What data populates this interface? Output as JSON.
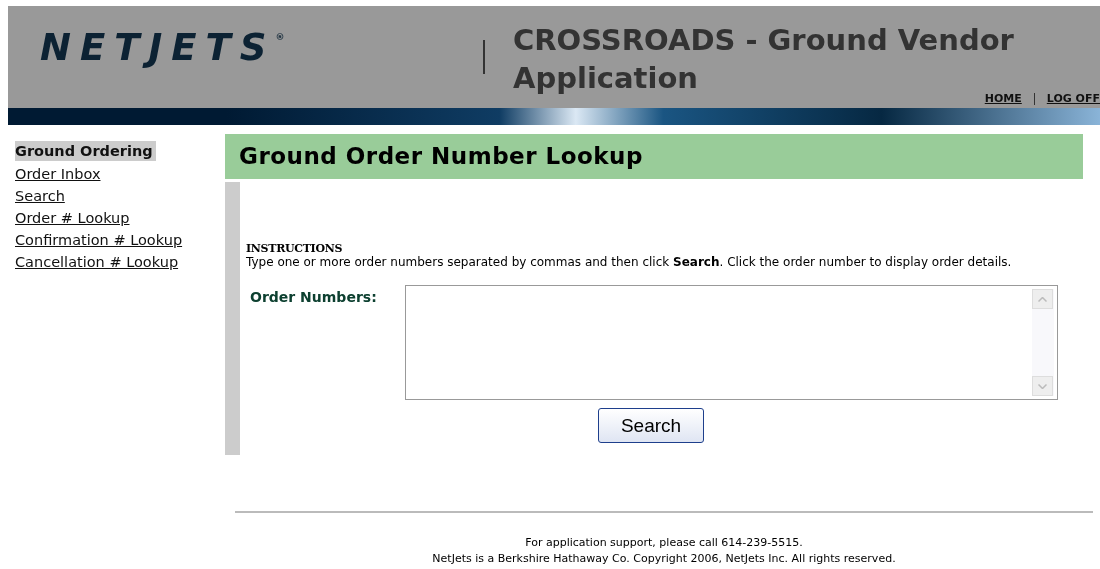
{
  "header": {
    "logo": "NETJETS",
    "logo_mark": "®",
    "title": "CROSSROADS - Ground Vendor Application",
    "nav": [
      {
        "label": "HOME"
      },
      {
        "label": "LOG OFF"
      }
    ]
  },
  "sidebar": {
    "items": [
      {
        "label": "Ground Ordering",
        "selected": true
      },
      {
        "label": "Order Inbox",
        "selected": false
      },
      {
        "label": "Search",
        "selected": false
      },
      {
        "label": "Order # Lookup",
        "selected": false
      },
      {
        "label": "Confirmation # Lookup",
        "selected": false
      },
      {
        "label": "Cancellation # Lookup",
        "selected": false
      }
    ]
  },
  "main": {
    "heading": "Ground Order Number Lookup",
    "instructions_title": "INSTRUCTIONS",
    "instructions": "Type one or more order numbers separated by commas and then click **Search**. Click the order number to display order details.",
    "field_label": "Order Numbers:",
    "button": "Search"
  },
  "footer": [
    "For application support, please call 614-239-5515.",
    "NetJets is a Berkshire Hathaway Co. Copyright 2006, NetJets Inc. All rights reserved."
  ]
}
